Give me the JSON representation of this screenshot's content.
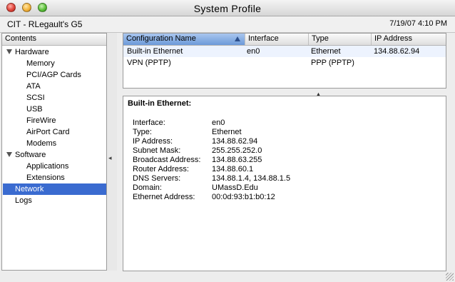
{
  "window": {
    "title": "System Profile"
  },
  "infobar": {
    "machine_name": "CIT - RLegault's G5",
    "datetime": "7/19/07 4:10 PM"
  },
  "sidebar": {
    "header": "Contents",
    "items": [
      {
        "label": "Hardware",
        "level": 0,
        "expanded": true
      },
      {
        "label": "Memory",
        "level": 1
      },
      {
        "label": "PCI/AGP Cards",
        "level": 1
      },
      {
        "label": "ATA",
        "level": 1
      },
      {
        "label": "SCSI",
        "level": 1
      },
      {
        "label": "USB",
        "level": 1
      },
      {
        "label": "FireWire",
        "level": 1
      },
      {
        "label": "AirPort Card",
        "level": 1
      },
      {
        "label": "Modems",
        "level": 1
      },
      {
        "label": "Software",
        "level": 0,
        "expanded": true
      },
      {
        "label": "Applications",
        "level": 1
      },
      {
        "label": "Extensions",
        "level": 1
      },
      {
        "label": "Network",
        "level": 0,
        "selected": true
      },
      {
        "label": "Logs",
        "level": 0
      }
    ]
  },
  "table": {
    "columns": [
      "Configuration Name",
      "Interface",
      "Type",
      "IP Address"
    ],
    "sorted_column": "Configuration Name",
    "rows": [
      [
        "Built-in Ethernet",
        "en0",
        "Ethernet",
        "134.88.62.94"
      ],
      [
        "VPN (PPTP)",
        "",
        "PPP (PPTP)",
        ""
      ]
    ]
  },
  "detail": {
    "title": "Built-in Ethernet:",
    "properties": [
      {
        "label": "Interface:",
        "value": "en0"
      },
      {
        "label": "Type:",
        "value": "Ethernet"
      },
      {
        "label": "IP Address:",
        "value": "134.88.62.94"
      },
      {
        "label": "Subnet Mask:",
        "value": "255.255.252.0"
      },
      {
        "label": "Broadcast Address:",
        "value": "134.88.63.255"
      },
      {
        "label": "Router Address:",
        "value": "134.88.60.1"
      },
      {
        "label": "DNS Servers:",
        "value": "134.88.1.4, 134.88.1.5"
      },
      {
        "label": "Domain:",
        "value": "UMassD.Edu"
      },
      {
        "label": "Ethernet Address:",
        "value": "00:0d:93:b1:b0:12"
      }
    ]
  },
  "colors": {
    "selection": "#3a6bd0",
    "sorted_header": "#6c9ad9"
  },
  "icons": [
    "close-button",
    "minimize-button",
    "zoom-button",
    "disclosure-triangle-icon",
    "sort-ascending-icon",
    "splitter-grip-icon",
    "resize-grip-icon"
  ]
}
